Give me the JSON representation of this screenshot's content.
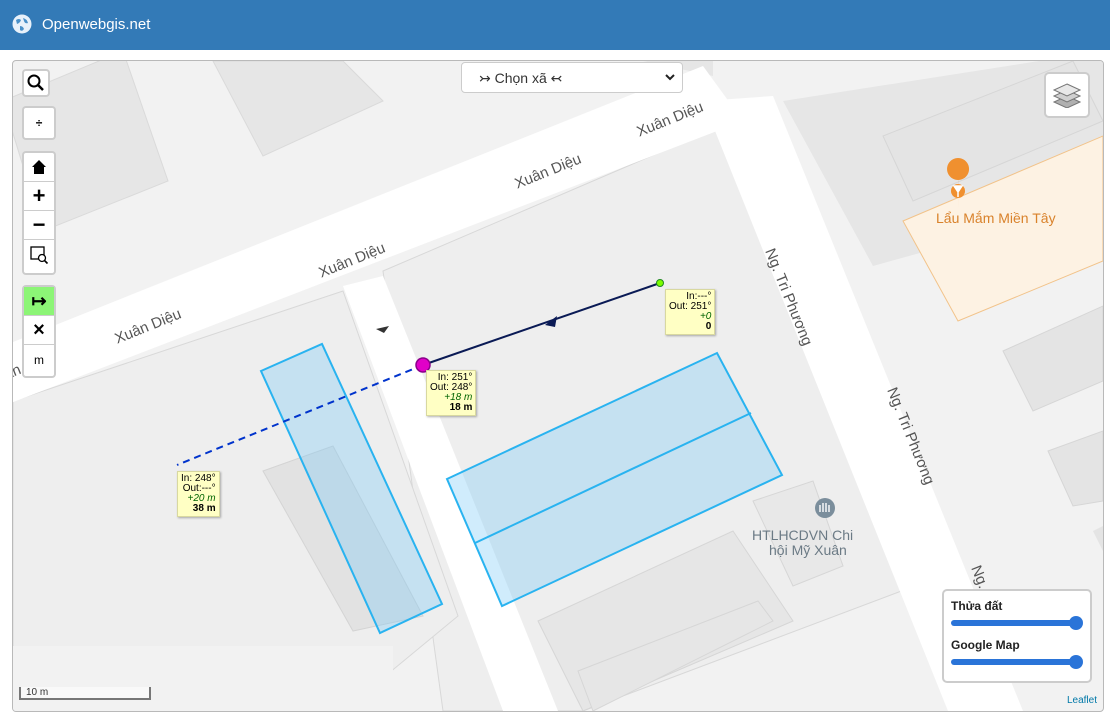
{
  "header": {
    "title": "Openwebgis.net"
  },
  "select": {
    "value": "↣ Chọn xã ↢"
  },
  "controls": {
    "search": "🔍",
    "locate": "÷",
    "home": "⌂",
    "zoom_in": "+",
    "zoom_out": "−",
    "measure": "↦",
    "clear": "×",
    "unit": "m"
  },
  "streets": {
    "xuan_dieu": "Xuân Diệu",
    "tri_phuong": "Ng. Tri Phương",
    "tri_phuong_short": "Ng.",
    "cut_left": "ân Diệu"
  },
  "pois": {
    "restaurant": "Lẩu Mắm Miền Tây",
    "htlhcdvn_line1": "HTLHCDVN Chi",
    "htlhcdvn_line2": "hội Mỹ Xuân"
  },
  "tooltips": {
    "start": {
      "in": "In:---°",
      "out": "Out: 251°",
      "delta": "+0",
      "total": "0"
    },
    "vertex": {
      "in": "In: 251°",
      "out": "Out: 248°",
      "delta": "+18 m",
      "total": "18 m"
    },
    "end": {
      "in": "In: 248°",
      "out": "Out:---°",
      "delta": "+20 m",
      "total": "38 m"
    }
  },
  "opacity": {
    "layer1": "Thửa đất",
    "layer1_value": 1.0,
    "layer2": "Google Map",
    "layer2_value": 1.0
  },
  "scale": "10 m",
  "attribution": "Leaflet"
}
